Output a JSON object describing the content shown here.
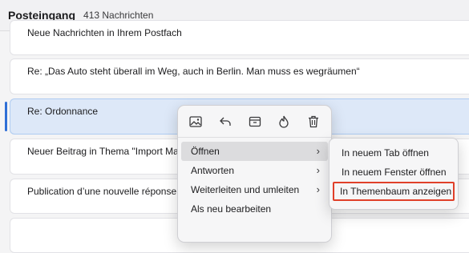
{
  "header": {
    "title": "Posteingang",
    "count": "413 Nachrichten"
  },
  "messages": [
    {
      "subject": "Neue Nachrichten in Ihrem Postfach"
    },
    {
      "subject": "Re: „Das Auto steht überall im Weg, auch in Berlin. Man muss es wegräumen“"
    },
    {
      "subject": "Re: Ordonnance"
    },
    {
      "subject": "Neuer Beitrag in Thema \"Import Ma"
    },
    {
      "subject": "Publication d’une nouvelle réponse"
    },
    {
      "subject": ""
    }
  ],
  "context_menu": {
    "icons": [
      "image-icon",
      "reply-icon",
      "archive-icon",
      "flame-icon",
      "trash-icon"
    ],
    "items": [
      {
        "label": "Öffnen",
        "has_submenu": true
      },
      {
        "label": "Antworten",
        "has_submenu": true
      },
      {
        "label": "Weiterleiten und umleiten",
        "has_submenu": true
      },
      {
        "label": "Als neu bearbeiten",
        "has_submenu": false
      }
    ]
  },
  "submenu": {
    "items": [
      {
        "label": "In neuem Tab öffnen"
      },
      {
        "label": "In neuem Fenster öffnen"
      },
      {
        "label": "In Themenbaum anzeigen"
      }
    ]
  },
  "colors": {
    "selection": "#dde8f8",
    "selection_indicator": "#2f6fd6",
    "highlight_outline": "#e0402a"
  }
}
